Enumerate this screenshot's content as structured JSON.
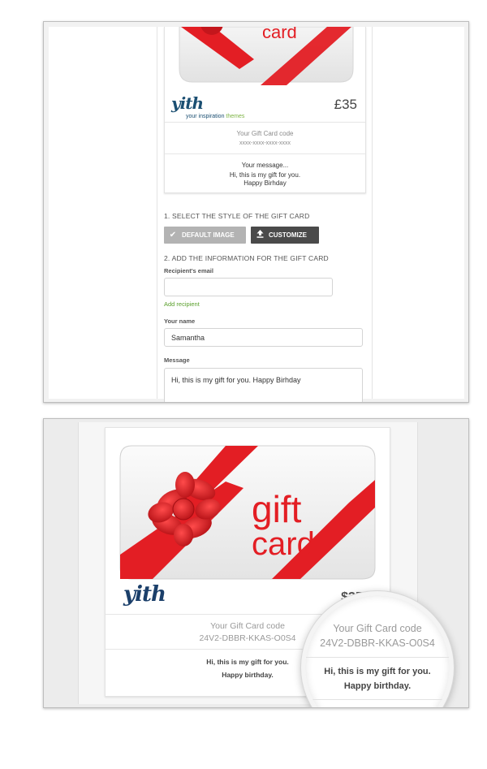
{
  "top_panel": {
    "preview": {
      "card_art_text": "card",
      "logo_word": "yith",
      "logo_tagline_start": "your inspiration",
      "logo_tagline_end": "themes",
      "price": "£35",
      "code_label": "Your Gift Card code",
      "code_value": "xxxx-xxxx-xxxx-xxxx",
      "message_title": "Your message...",
      "message_line1": "Hi, this is my gift for you.",
      "message_line2": "Happy Birhday"
    },
    "step1_title": "1. SELECT THE STYLE OF THE GIFT CARD",
    "default_image_label": "DEFAULT IMAGE",
    "customize_label": "CUSTOMIZE",
    "step2_title": "2. ADD THE INFORMATION FOR THE GIFT CARD",
    "recipient_email_label": "Recipient's email",
    "recipient_email_value": "",
    "add_recipient_label": "Add recipient",
    "your_name_label": "Your name",
    "your_name_value": "Samantha",
    "message_label": "Message",
    "message_value": "Hi, this is my gift for you. Happy Birhday"
  },
  "bottom_panel": {
    "card_word_1": "gift",
    "card_word_2": "card",
    "logo_word": "yith",
    "price": "$35.00",
    "code_label": "Your Gift Card code",
    "code_value": "24V2-DBBR-KKAS-O0S4",
    "message_line1": "Hi, this is my gift for you.",
    "message_line2": "Happy birthday."
  },
  "magnifier": {
    "code_label": "Your Gift Card code",
    "code_value": "24V2-DBBR-KKAS-O0S4",
    "message_line1": "Hi, this is my gift for you.",
    "message_line2": "Happy birthday."
  },
  "colors": {
    "ribbon_red": "#e31e24",
    "brand_blue": "#1b4f72",
    "link_green": "#5aa02c",
    "customize_button": "#4a4a4a",
    "default_button": "#b3b3b3"
  },
  "icons": {
    "default_image": "check-icon",
    "customize": "upload-icon"
  }
}
